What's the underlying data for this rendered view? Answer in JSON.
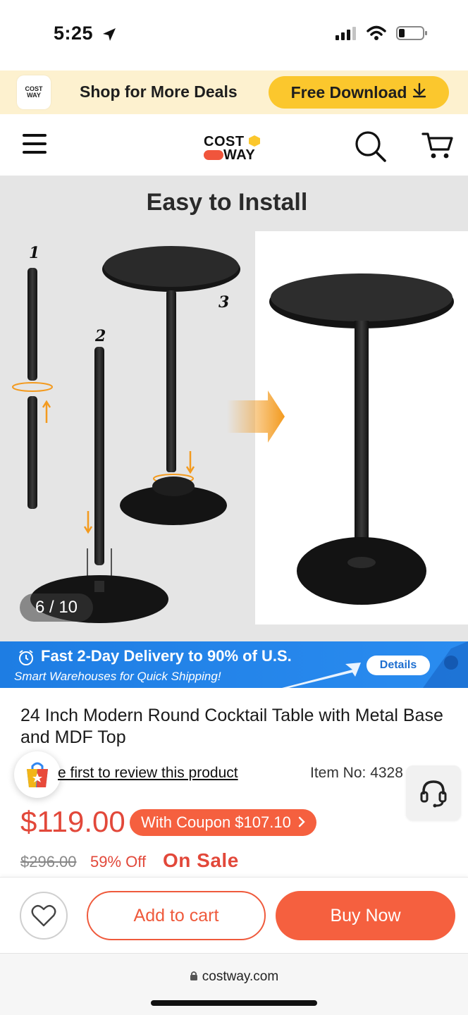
{
  "status_bar": {
    "time": "5:25"
  },
  "promo": {
    "logo_line1": "COST",
    "logo_line2": "WAY",
    "text": "Shop for More Deals",
    "download_label": "Free Download"
  },
  "header": {
    "brand_top": "COST",
    "brand_bottom": "WAY"
  },
  "gallery": {
    "title": "Easy to Install",
    "steps": [
      "1",
      "2",
      "3"
    ],
    "counter": "6 / 10"
  },
  "delivery": {
    "title": "Fast 2-Day Delivery to 90% of U.S.",
    "subtitle": "Smart Warehouses for Quick Shipping!",
    "details_label": "Details"
  },
  "product": {
    "title": "24 Inch Modern Round Cocktail Table with Metal Base and MDF Top",
    "review_link": "e first to review this product",
    "item_no": "Item No: 4328",
    "price": "$119.00",
    "coupon": "With Coupon $107.10",
    "old_price": "$296.00",
    "discount": "59% Off",
    "sale_label": "On Sale"
  },
  "actions": {
    "add_to_cart": "Add to cart",
    "buy_now": "Buy Now"
  },
  "url_bar": {
    "domain": "costway.com"
  },
  "colors": {
    "accent": "#f5603f",
    "promo_yellow": "#fbc72d",
    "delivery_blue": "#1e7de3",
    "price_red": "#e2483a"
  }
}
